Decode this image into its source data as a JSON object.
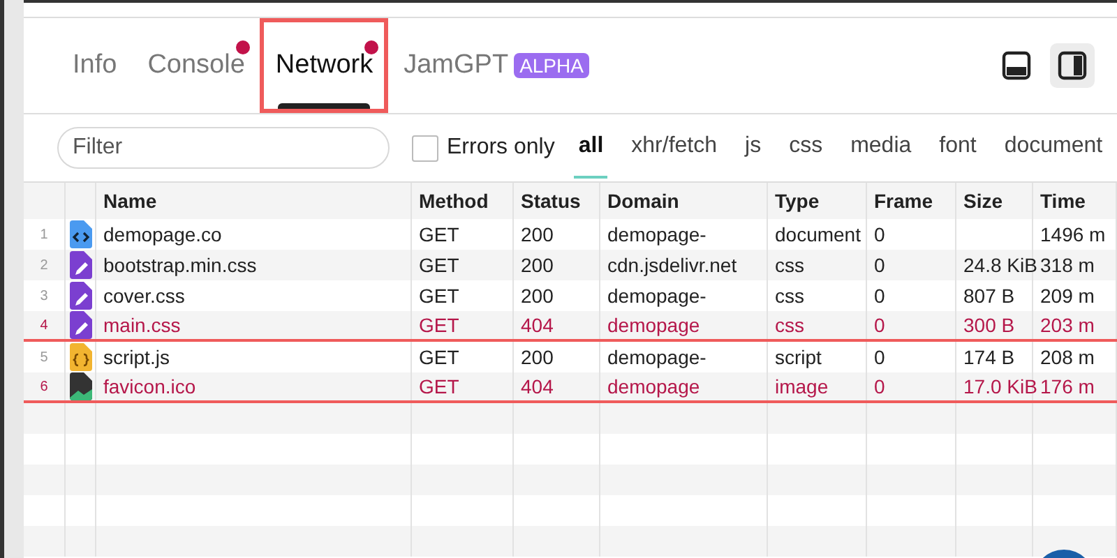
{
  "tabs": [
    {
      "label": "Info",
      "selected": false,
      "dot": false,
      "highlighted": false
    },
    {
      "label": "Console",
      "selected": false,
      "dot": true,
      "highlighted": false
    },
    {
      "label": "Network",
      "selected": true,
      "dot": true,
      "highlighted": true
    },
    {
      "label": "JamGPT",
      "selected": false,
      "dot": false,
      "highlighted": false,
      "badge": "ALPHA"
    }
  ],
  "layout_buttons": [
    {
      "kind": "bottom",
      "selected": false
    },
    {
      "kind": "right",
      "selected": true
    }
  ],
  "filter": {
    "placeholder": "Filter"
  },
  "errors_only": {
    "label": "Errors only",
    "checked": false
  },
  "type_filters": [
    {
      "label": "all",
      "selected": true
    },
    {
      "label": "xhr/fetch",
      "selected": false
    },
    {
      "label": "js",
      "selected": false
    },
    {
      "label": "css",
      "selected": false
    },
    {
      "label": "media",
      "selected": false
    },
    {
      "label": "font",
      "selected": false
    },
    {
      "label": "document",
      "selected": false
    }
  ],
  "table": {
    "columns": [
      "Name",
      "Method",
      "Status",
      "Domain",
      "Type",
      "Frame",
      "Size",
      "Time"
    ],
    "rows": [
      {
        "index": "1",
        "kind": "document",
        "error": false,
        "underlined": false,
        "cells": [
          "demopage.co",
          "GET",
          "200",
          "demopage-",
          "document",
          "0",
          "",
          "1496 m"
        ]
      },
      {
        "index": "2",
        "kind": "css",
        "error": false,
        "underlined": false,
        "cells": [
          "bootstrap.min.css",
          "GET",
          "200",
          "cdn.jsdelivr.net",
          "css",
          "0",
          "24.8 KiB",
          "318 m"
        ]
      },
      {
        "index": "3",
        "kind": "css",
        "error": false,
        "underlined": false,
        "cells": [
          "cover.css",
          "GET",
          "200",
          "demopage-",
          "css",
          "0",
          "807 B",
          "209 m"
        ]
      },
      {
        "index": "4",
        "kind": "css",
        "error": true,
        "underlined": true,
        "cells": [
          "main.css",
          "GET",
          "404",
          "demopage",
          "css",
          "0",
          "300 B",
          "203 m"
        ]
      },
      {
        "index": "5",
        "kind": "script",
        "error": false,
        "underlined": false,
        "cells": [
          "script.js",
          "GET",
          "200",
          "demopage-",
          "script",
          "0",
          "174 B",
          "208 m"
        ]
      },
      {
        "index": "6",
        "kind": "image",
        "error": true,
        "underlined": true,
        "cells": [
          "favicon.ico",
          "GET",
          "404",
          "demopage",
          "image",
          "0",
          "17.0 KiB",
          "176 m"
        ]
      }
    ]
  }
}
